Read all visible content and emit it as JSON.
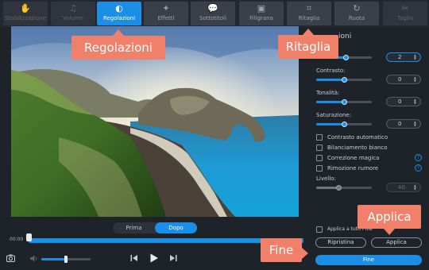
{
  "toolbar": {
    "tabs": [
      {
        "label": "Stabilizzazione",
        "icon": "hand-icon",
        "glyph": "✋",
        "state": "disabled"
      },
      {
        "label": "Volume",
        "icon": "music-note-icon",
        "glyph": "♫",
        "state": "disabled"
      },
      {
        "label": "Regolazioni",
        "icon": "contrast-icon",
        "glyph": "◐",
        "state": "active"
      },
      {
        "label": "Effetti",
        "icon": "magic-wand-icon",
        "glyph": "✦",
        "state": "normal"
      },
      {
        "label": "Sottotitoli",
        "icon": "speech-bubble-icon",
        "glyph": "💬",
        "state": "normal"
      },
      {
        "label": "Filigrana",
        "icon": "watermark-icon",
        "glyph": "▣",
        "state": "normal"
      },
      {
        "label": "Ritaglia",
        "icon": "crop-icon",
        "glyph": "⌗",
        "state": "normal"
      },
      {
        "label": "Ruota",
        "icon": "rotate-icon",
        "glyph": "↻",
        "state": "normal"
      },
      {
        "label": "Taglia",
        "icon": "scissors-icon",
        "glyph": "✂",
        "state": "disabled"
      }
    ]
  },
  "preview": {
    "toggle": {
      "before": "Prima",
      "after": "Dopo",
      "selected": "Dopo"
    }
  },
  "timeline": {
    "time": "00:00",
    "progress": 1.0
  },
  "volume": {
    "level": 0.5
  },
  "panel": {
    "title_partial": "ioni",
    "sliders": [
      {
        "label": "",
        "value": "2",
        "level": 0.53
      },
      {
        "label": "Contrasto:",
        "value": "0",
        "level": 0.5
      },
      {
        "label": "Tonalità:",
        "value": "0",
        "level": 0.5
      },
      {
        "label": "Saturazione:",
        "value": "0",
        "level": 0.5
      }
    ],
    "checks": [
      {
        "label": "Contrasto automatico",
        "help": false
      },
      {
        "label": "Bilanciamento bianco",
        "help": false
      },
      {
        "label": "Correzione magica",
        "help": true
      },
      {
        "label": "Rimozione rumore",
        "help": true
      }
    ],
    "level": {
      "label": "Livello:",
      "value": "40",
      "level": 0.4
    },
    "apply_all": "Applica a tutti i file",
    "reset": "Ripristina",
    "apply": "Applica",
    "done": "Fine"
  },
  "callouts": {
    "adjustments": "Regolazioni",
    "crop": "Ritaglia",
    "apply": "Applica",
    "done": "Fine"
  },
  "colors": {
    "accent": "#1b8ee6",
    "callout": "#f0806a",
    "background": "#1e2229"
  }
}
